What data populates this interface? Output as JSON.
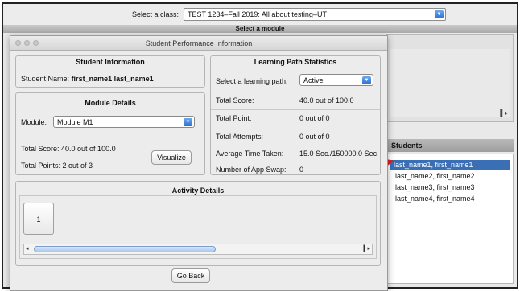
{
  "background": {
    "class_label": "Select a class:",
    "class_value": "TEST 1234–Fall 2019: All about testing–UT",
    "module_header": "Select a module",
    "students_header": "Students",
    "students": [
      "last_name1, first_name1",
      "last_name2, first_name2",
      "last_name3, first_name3",
      "last_name4, first_name4"
    ],
    "selected_student_index": 0,
    "arrow_color": "#e02020"
  },
  "dialog": {
    "title": "Student Performance Information",
    "student_info": {
      "heading": "Student Information",
      "name_label": "Student Name:",
      "name_value": "first_name1 last_name1"
    },
    "module_details": {
      "heading": "Module Details",
      "module_label": "Module:",
      "module_value": "Module M1",
      "total_score": "Total Score: 40.0 out of 100.0",
      "total_points": "Total Points: 2 out of 3",
      "visualize_label": "Visualize"
    },
    "lp_stats": {
      "heading": "Learning Path Statistics",
      "select_label": "Select a learning path:",
      "select_value": "Active",
      "rows": [
        {
          "label": "Total Score:",
          "value": "40.0 out of 100.0"
        },
        {
          "label": "Total Point:",
          "value": "0 out of 0"
        },
        {
          "label": "Total Attempts:",
          "value": "0 out of 0"
        },
        {
          "label": "Average Time Taken:",
          "value": "15.0 Sec./150000.0 Sec."
        },
        {
          "label": "Number of App Swap:",
          "value": "0"
        }
      ]
    },
    "activity": {
      "heading": "Activity Details",
      "items": [
        "1"
      ]
    },
    "go_back_label": "Go Back"
  }
}
